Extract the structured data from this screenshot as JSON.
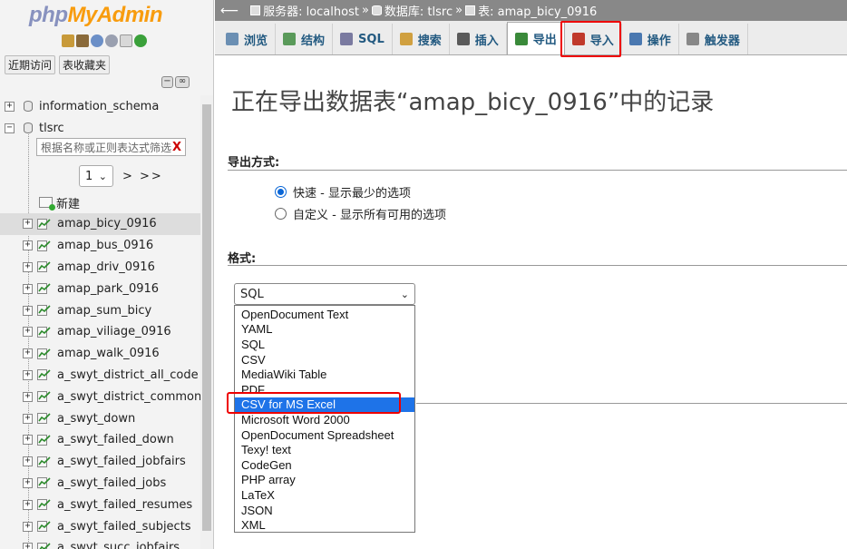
{
  "logo": {
    "php": "php",
    "myadmin": "MyAdmin"
  },
  "sidebar": {
    "recent_label": "近期访问",
    "favorites_label": "表收藏夹",
    "databases": [
      {
        "name": "information_schema"
      },
      {
        "name": "tlsrc"
      }
    ],
    "filter_placeholder": "根据名称或正则表达式筛选",
    "filter_clear": "X",
    "page_value": "1",
    "page_next": "> >>",
    "new_label": "新建",
    "tables": [
      "amap_bicy_0916",
      "amap_bus_0916",
      "amap_driv_0916",
      "amap_park_0916",
      "amap_sum_bicy",
      "amap_viliage_0916",
      "amap_walk_0916",
      "a_swyt_district_all_code",
      "a_swyt_district_common_",
      "a_swyt_down",
      "a_swyt_failed_down",
      "a_swyt_failed_jobfairs",
      "a_swyt_failed_jobs",
      "a_swyt_failed_resumes",
      "a_swyt_failed_subjects",
      "a_swyt_succ_jobfairs"
    ]
  },
  "breadcrumb": {
    "server": "服务器: localhost",
    "database": "数据库: tlsrc",
    "table": "表: amap_bicy_0916",
    "sep": "»"
  },
  "tabs": [
    {
      "label": "浏览",
      "icon": "browse-icon",
      "color": "#6b8fb3"
    },
    {
      "label": "结构",
      "icon": "structure-icon",
      "color": "#5a9a5a"
    },
    {
      "label": "SQL",
      "icon": "sql-icon",
      "color": "#7a7aa0"
    },
    {
      "label": "搜索",
      "icon": "search-icon",
      "color": "#d0a040"
    },
    {
      "label": "插入",
      "icon": "insert-icon",
      "color": "#5b5b5b"
    },
    {
      "label": "导出",
      "icon": "export-icon",
      "color": "#3a8a3a"
    },
    {
      "label": "导入",
      "icon": "import-icon",
      "color": "#c0392b"
    },
    {
      "label": "操作",
      "icon": "operations-icon",
      "color": "#4a78b0"
    },
    {
      "label": "触发器",
      "icon": "triggers-icon",
      "color": "#888888"
    }
  ],
  "main": {
    "title": "正在导出数据表“amap_bicy_0916”中的记录",
    "method_label": "导出方式:",
    "method_quick": "快速 - 显示最少的选项",
    "method_custom": "自定义 - 显示所有可用的选项",
    "format_label": "格式:",
    "format_selected": "SQL",
    "format_options": [
      "OpenDocument Text",
      "YAML",
      "SQL",
      "CSV",
      "MediaWiki Table",
      "PDF",
      "CSV for MS Excel",
      "Microsoft Word 2000",
      "OpenDocument Spreadsheet",
      "Texy! text",
      "CodeGen",
      "PHP array",
      "LaTeX",
      "JSON",
      "XML"
    ],
    "highlighted_option_index": 6
  }
}
